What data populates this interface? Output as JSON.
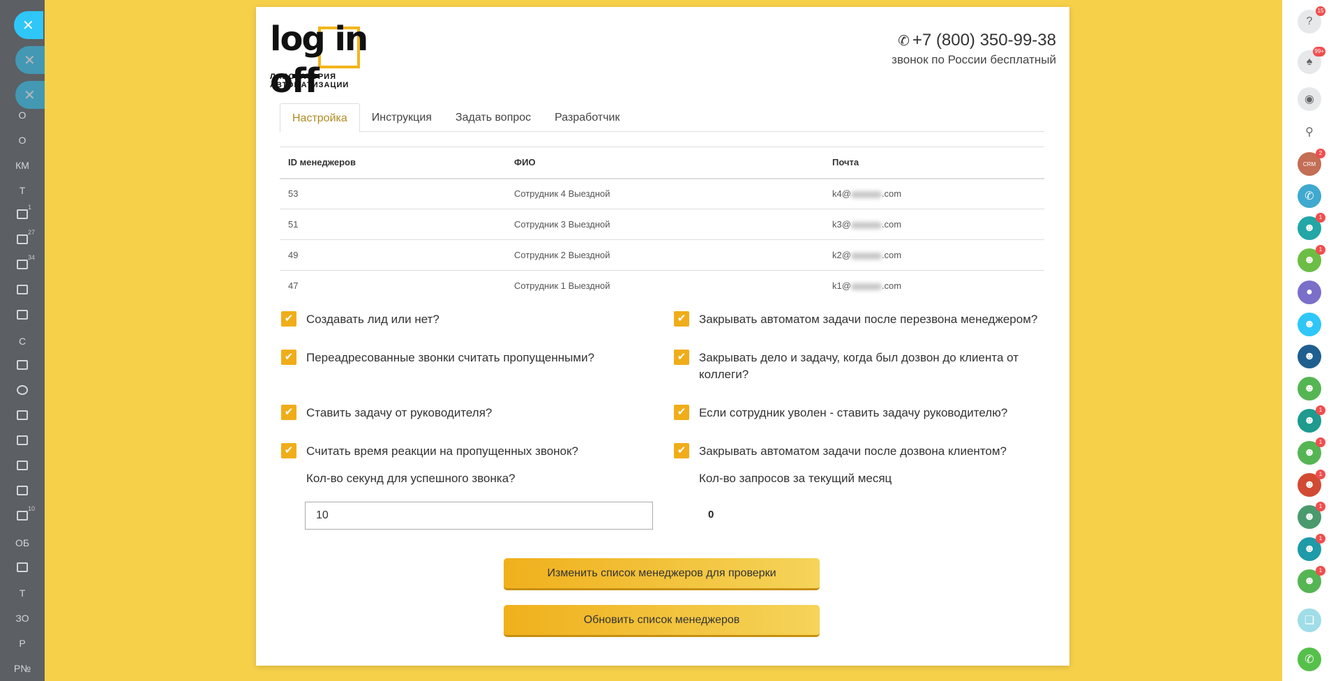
{
  "app": {
    "logo_text": "log in off",
    "logo_sub": "ЛАБОРАТОРИЯ АВТОМАТИЗАЦИИ",
    "phone": "+7 (800) 350-99-38",
    "phone_note": "звонок по России бесплатный"
  },
  "tabs": [
    {
      "label": "Настройка",
      "active": true
    },
    {
      "label": "Инструкция",
      "active": false
    },
    {
      "label": "Задать вопрос",
      "active": false
    },
    {
      "label": "Разработчик",
      "active": false
    }
  ],
  "table": {
    "headers": [
      "ID менеджеров",
      "ФИО",
      "Почта"
    ],
    "rows": [
      {
        "id": "53",
        "name": "Сотрудник 4 Выездной",
        "email_prefix": "k4@",
        "email_suffix": ".com"
      },
      {
        "id": "51",
        "name": "Сотрудник 3 Выездной",
        "email_prefix": "k3@",
        "email_suffix": ".com"
      },
      {
        "id": "49",
        "name": "Сотрудник 2 Выездной",
        "email_prefix": "k2@",
        "email_suffix": ".com"
      },
      {
        "id": "47",
        "name": "Сотрудник 1 Выездной",
        "email_prefix": "k1@",
        "email_suffix": ".com"
      }
    ]
  },
  "options": {
    "create_lead": "Создавать лид или нет?",
    "forwarded_missed": "Переадресованные звонки считать пропущенными?",
    "task_from_head": "Ставить задачу от руководителя?",
    "reaction_time": "Считать время реакции на пропущенных звонок?",
    "close_after_callback": "Закрывать автоматом задачи после перезвона менеджером?",
    "close_when_colleague": "Закрывать дело и задачу, когда был дозвон до клиента от коллеги?",
    "fired_to_head": "Если сотрудник уволен - ставить задачу руководителю?",
    "close_after_client": "Закрывать автоматом задачи после дозвона клиентом?",
    "checkmark": "✔"
  },
  "seconds_label": "Кол-во секунд для успешного звонка?",
  "seconds_value": "10",
  "requests_label": "Кол-во запросов за текущий месяц",
  "requests_value": "0",
  "buttons": {
    "change_list": "Изменить список менеджеров для проверки",
    "refresh_list": "Обновить список менеджеров"
  },
  "left_sidebar": {
    "items": [
      {
        "label": "О"
      },
      {
        "label": "О"
      },
      {
        "label": "КМ"
      },
      {
        "label": "Т"
      },
      {
        "label": "",
        "count": "1"
      },
      {
        "label": "",
        "count": "27"
      },
      {
        "label": "",
        "count": "34"
      },
      {
        "label": ""
      },
      {
        "label": ""
      },
      {
        "label": "С"
      },
      {
        "label": ""
      },
      {
        "label": ""
      },
      {
        "label": ""
      },
      {
        "label": ""
      },
      {
        "label": ""
      },
      {
        "label": ""
      },
      {
        "label": "",
        "count": "10"
      },
      {
        "label": "ОБ"
      },
      {
        "label": ""
      },
      {
        "label": "Т"
      },
      {
        "label": "ЗО"
      },
      {
        "label": "Р"
      },
      {
        "label": "Р№"
      }
    ],
    "close_symbol": "✕"
  },
  "right_sidebar": {
    "help_badge": "15",
    "notify_badge": "99+",
    "crm_badge": "2",
    "crm_label": "CRM",
    "user_badge": "1"
  }
}
